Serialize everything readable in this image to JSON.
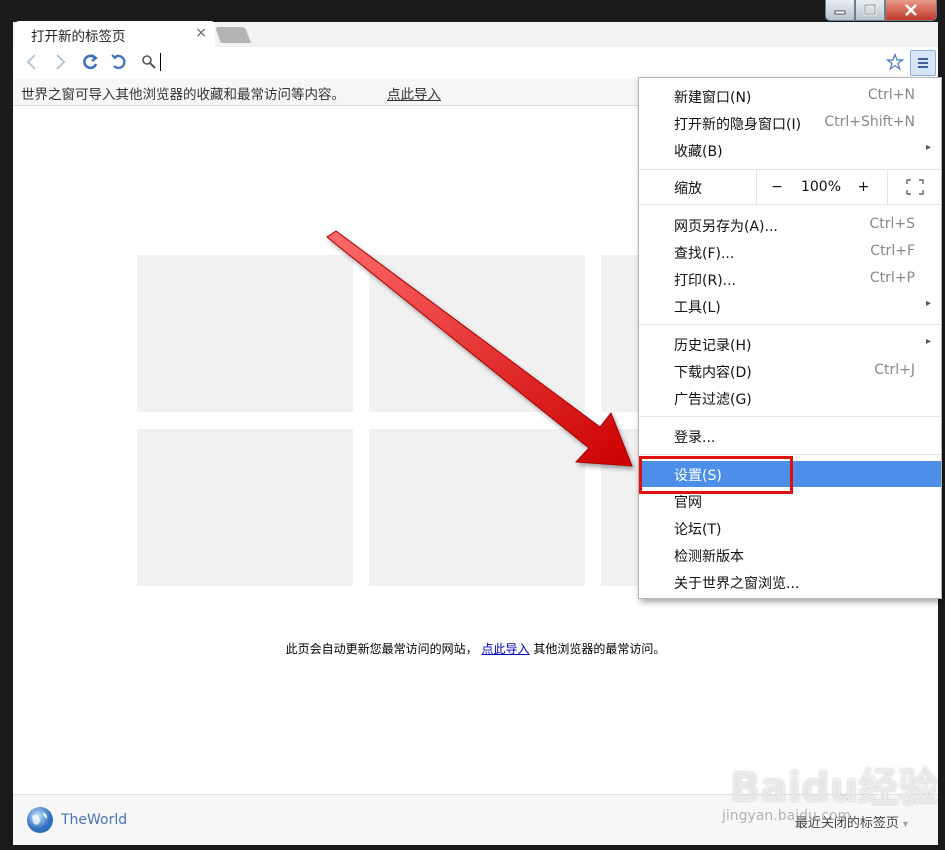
{
  "window": {
    "min_icon": "minimize-icon",
    "max_icon": "maximize-icon",
    "close_icon": "close-icon"
  },
  "tab": {
    "title": "打开新的标签页",
    "close": "×"
  },
  "infobar": {
    "text": "世界之窗可导入其他浏览器的收藏和最常访问等内容。",
    "link": "点此导入"
  },
  "content": {
    "note_before": "此页会自动更新您最常访问的网站，",
    "note_link": "点此导入",
    "note_after": " 其他浏览器的最常访问。"
  },
  "footer": {
    "brand": "TheWorld",
    "recent": "最近关闭的标签页"
  },
  "watermark": {
    "main": "Baidu经验",
    "sub": "jingyan.baidu.com"
  },
  "menu": {
    "new_window": {
      "label": "新建窗口(N)",
      "shortcut": "Ctrl+N"
    },
    "incognito": {
      "label": "打开新的隐身窗口(I)",
      "shortcut": "Ctrl+Shift+N"
    },
    "bookmarks": {
      "label": "收藏(B)"
    },
    "zoom": {
      "label": "缩放",
      "minus": "−",
      "value": "100%",
      "plus": "+"
    },
    "save_as": {
      "label": "网页另存为(A)...",
      "shortcut": "Ctrl+S"
    },
    "find": {
      "label": "查找(F)...",
      "shortcut": "Ctrl+F"
    },
    "print": {
      "label": "打印(R)...",
      "shortcut": "Ctrl+P"
    },
    "tools": {
      "label": "工具(L)"
    },
    "history": {
      "label": "历史记录(H)"
    },
    "downloads": {
      "label": "下载内容(D)",
      "shortcut": "Ctrl+J"
    },
    "adblock": {
      "label": "广告过滤(G)"
    },
    "login": {
      "label": "登录..."
    },
    "settings": {
      "label": "设置(S)"
    },
    "website": {
      "label": "官网"
    },
    "forum": {
      "label": "论坛(T)"
    },
    "update": {
      "label": "检测新版本"
    },
    "about": {
      "label": "关于世界之窗浏览..."
    }
  },
  "colors": {
    "highlight": "#4d8ee9",
    "annotation_red": "#e01010"
  }
}
